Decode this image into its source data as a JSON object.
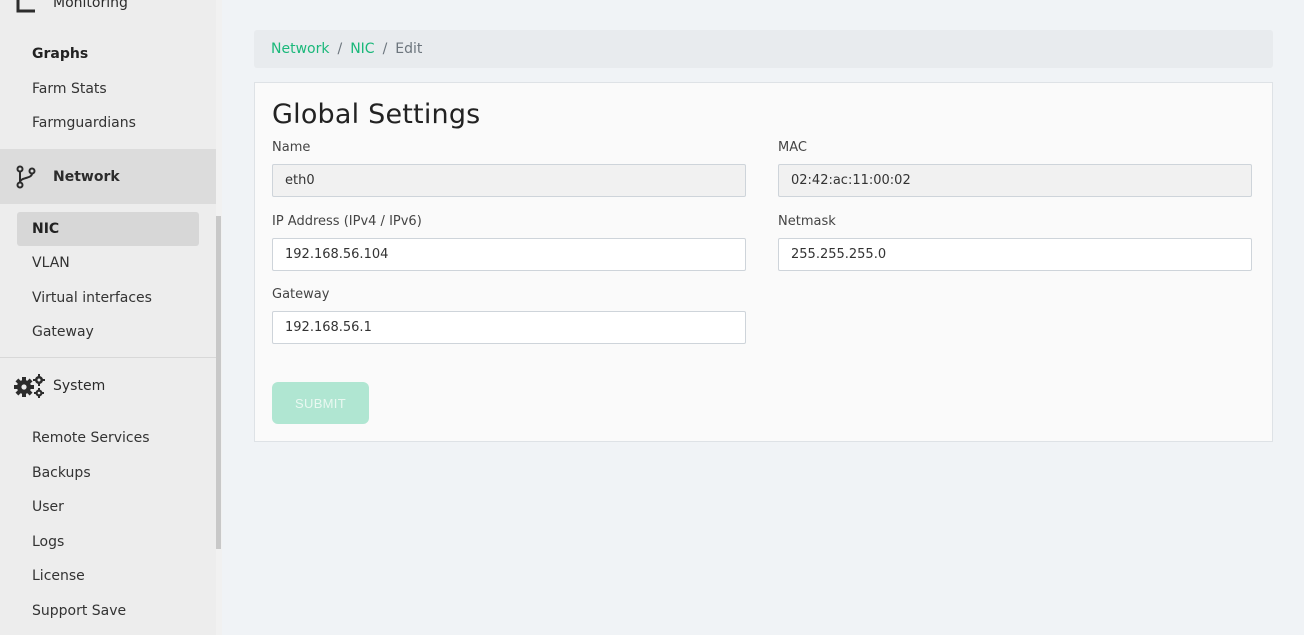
{
  "sidebar": {
    "monitoring": {
      "label": "Monitoring",
      "items": [
        "Graphs",
        "Farm Stats",
        "Farmguardians"
      ]
    },
    "network": {
      "label": "Network",
      "items": [
        "NIC",
        "VLAN",
        "Virtual interfaces",
        "Gateway"
      ]
    },
    "system": {
      "label": "System",
      "items": [
        "Remote Services",
        "Backups",
        "User",
        "Logs",
        "License",
        "Support Save"
      ]
    }
  },
  "breadcrumb": {
    "items": [
      "Network",
      "NIC"
    ],
    "current": "Edit"
  },
  "form": {
    "title": "Global Settings",
    "name": {
      "label": "Name",
      "value": "eth0"
    },
    "mac": {
      "label": "MAC",
      "value": "02:42:ac:11:00:02"
    },
    "ip": {
      "label": "IP Address (IPv4 / IPv6)",
      "value": "192.168.56.104"
    },
    "netmask": {
      "label": "Netmask",
      "value": "255.255.255.0"
    },
    "gateway": {
      "label": "Gateway",
      "value": "192.168.56.1"
    },
    "submit_label": "SUBMIT"
  },
  "colors": {
    "accent": "#1ab87a",
    "submit_disabled": "#b0e6d2"
  }
}
